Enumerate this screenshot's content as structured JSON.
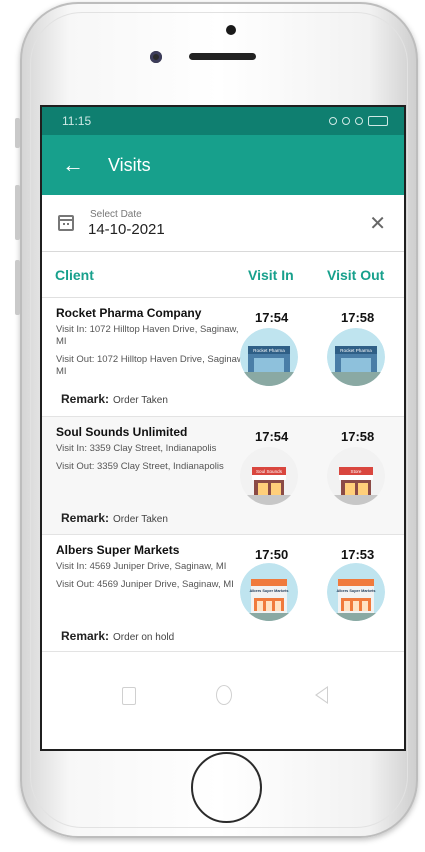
{
  "status_bar": {
    "time": "11:15"
  },
  "appbar": {
    "back_icon": "arrow-back-icon",
    "title": "Visits"
  },
  "date_filter": {
    "label": "Select Date",
    "value": "14-10-2021",
    "clear_icon": "close-icon"
  },
  "table": {
    "headers": {
      "client": "Client",
      "visit_in": "Visit In",
      "visit_out": "Visit Out"
    },
    "rows": [
      {
        "client": "Rocket Pharma Company",
        "visit_in_address": "Visit In: 1072 Hilltop Haven Drive, Saginaw, MI",
        "visit_out_address": "Visit Out: 1072 Hilltop Haven Drive, Saginaw, MI",
        "remark_label": "Remark:",
        "remark": "Order Taken",
        "visit_in_time": "17:54",
        "visit_out_time": "17:58",
        "visit_in_sign": "Rocket Pharma",
        "visit_out_sign": "Rocket Pharma"
      },
      {
        "client": "Soul Sounds Unlimited",
        "visit_in_address": "Visit In: 3359 Clay Street, Indianapolis",
        "visit_out_address": "Visit Out: 3359 Clay Street, Indianapolis",
        "remark_label": "Remark:",
        "remark": "Order Taken",
        "visit_in_time": "17:54",
        "visit_out_time": "17:58",
        "visit_in_sign": "Soul Sounds",
        "visit_out_sign": "Store"
      },
      {
        "client": "Albers Super Markets",
        "visit_in_address": "Visit In: 4569 Juniper Drive, Saginaw, MI",
        "visit_out_address": "Visit Out: 4569 Juniper Drive, Saginaw, MI",
        "remark_label": "Remark:",
        "remark": "Order on hold",
        "visit_in_time": "17:50",
        "visit_out_time": "17:53",
        "visit_in_sign": "Albers Super Markets",
        "visit_out_sign": "Albers Super Markets"
      }
    ]
  },
  "nav": {
    "recent": "recent-apps-icon",
    "home": "home-icon",
    "back": "back-icon"
  },
  "colors": {
    "primary": "#17a08c",
    "primary_dark": "#0f7f70"
  }
}
